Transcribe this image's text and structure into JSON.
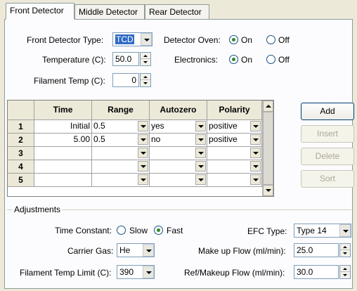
{
  "tabs": [
    {
      "label": "Front Detector",
      "active": true
    },
    {
      "label": "Middle Detector",
      "active": false
    },
    {
      "label": "Rear Detector",
      "active": false
    }
  ],
  "detector": {
    "type_label": "Front Detector Type:",
    "type_value": "TCD",
    "oven_label": "Detector Oven:",
    "oven_on_label": "On",
    "oven_off_label": "Off",
    "oven_selected": "On",
    "temperature_label": "Temperature (C):",
    "temperature_value": "50.0",
    "electronics_label": "Electronics:",
    "electronics_on_label": "On",
    "electronics_off_label": "Off",
    "electronics_selected": "On",
    "filament_temp_label": "Filament Temp (C):",
    "filament_temp_value": "0"
  },
  "table": {
    "columns": [
      "Time",
      "Range",
      "Autozero",
      "Polarity"
    ],
    "rows": [
      {
        "num": "1",
        "time": "Initial",
        "range": "0.5",
        "autozero": "yes",
        "polarity": "positive"
      },
      {
        "num": "2",
        "time": "5.00",
        "range": "0.5",
        "autozero": "no",
        "polarity": "positive"
      },
      {
        "num": "3",
        "time": "",
        "range": "",
        "autozero": "",
        "polarity": ""
      },
      {
        "num": "4",
        "time": "",
        "range": "",
        "autozero": "",
        "polarity": ""
      },
      {
        "num": "5",
        "time": "",
        "range": "",
        "autozero": "",
        "polarity": ""
      }
    ]
  },
  "buttons": {
    "add": "Add",
    "insert": "Insert",
    "delete": "Delete",
    "sort": "Sort"
  },
  "adjustments": {
    "title": "Adjustments",
    "time_constant_label": "Time Constant:",
    "slow_label": "Slow",
    "fast_label": "Fast",
    "time_constant_selected": "Fast",
    "efc_type_label": "EFC Type:",
    "efc_type_value": "Type 14",
    "carrier_gas_label": "Carrier Gas:",
    "carrier_gas_value": "He",
    "makeup_flow_label": "Make up Flow (ml/min):",
    "makeup_flow_value": "25.0",
    "filament_limit_label": "Filament Temp Limit (C):",
    "filament_limit_value": "390",
    "ref_makeup_label": "Ref/Makeup Flow (ml/min):",
    "ref_makeup_value": "30.0"
  },
  "colors": {
    "window_bg": "#ece9d8",
    "panel_bg": "#fcfcfe",
    "selection": "#316ac5",
    "radio_dot": "#2a8a2a"
  }
}
